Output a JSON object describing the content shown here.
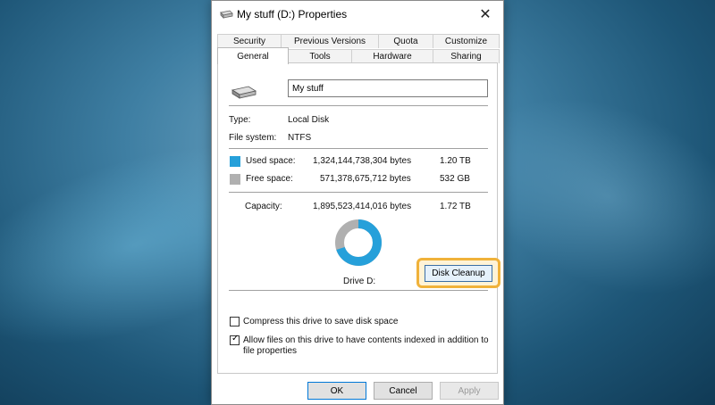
{
  "window": {
    "title": "My stuff (D:) Properties",
    "close_glyph": "✕"
  },
  "tabs": {
    "row1": [
      "Security",
      "Previous Versions",
      "Quota",
      "Customize"
    ],
    "row2": [
      "General",
      "Tools",
      "Hardware",
      "Sharing"
    ]
  },
  "general": {
    "name_value": "My stuff",
    "type_label": "Type:",
    "type_value": "Local Disk",
    "fs_label": "File system:",
    "fs_value": "NTFS",
    "used": {
      "label": "Used space:",
      "bytes": "1,324,144,738,304 bytes",
      "size": "1.20 TB",
      "color": "#26a0da"
    },
    "free": {
      "label": "Free space:",
      "bytes": "571,378,675,712 bytes",
      "size": "532 GB",
      "color": "#b0b0b0"
    },
    "capacity": {
      "label": "Capacity:",
      "bytes": "1,895,523,414,016 bytes",
      "size": "1.72 TB"
    },
    "drive_label": "Drive D:",
    "used_fraction": 0.6986,
    "cleanup_label": "Disk Cleanup",
    "compress_label": "Compress this drive to save disk space",
    "compress_checked": false,
    "index_label_line1": "Allow files on this drive to have contents indexed in addition to",
    "index_label_line2": "file properties",
    "index_checked": true
  },
  "footer": {
    "ok": "OK",
    "cancel": "Cancel",
    "apply": "Apply"
  }
}
